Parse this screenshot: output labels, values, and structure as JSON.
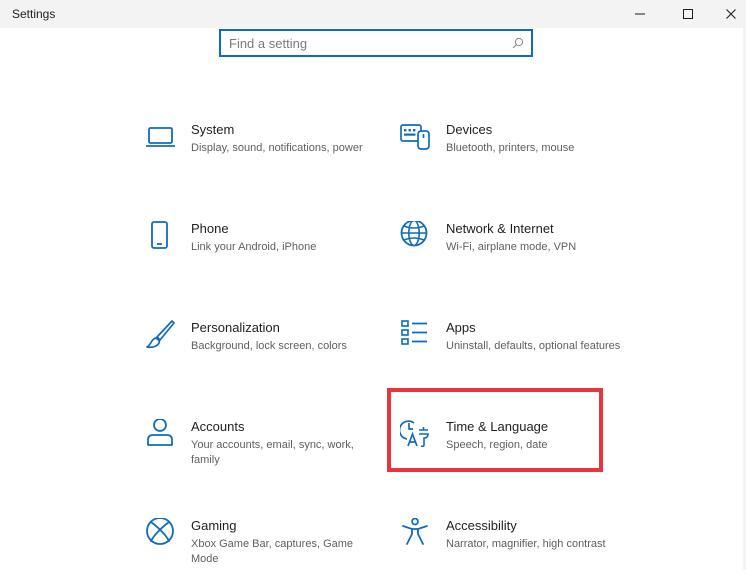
{
  "window": {
    "title": "Settings",
    "minimize_icon": "minimize-icon",
    "maximize_icon": "maximize-icon",
    "close_icon": "close-icon"
  },
  "search": {
    "placeholder": "Find a setting",
    "value": "",
    "icon": "search-icon"
  },
  "tiles": [
    {
      "title": "System",
      "desc": "Display, sound, notifications, power",
      "icon": "laptop-icon"
    },
    {
      "title": "Devices",
      "desc": "Bluetooth, printers, mouse",
      "icon": "devices-icon"
    },
    {
      "title": "Phone",
      "desc": "Link your Android, iPhone",
      "icon": "phone-icon"
    },
    {
      "title": "Network & Internet",
      "desc": "Wi-Fi, airplane mode, VPN",
      "icon": "globe-icon"
    },
    {
      "title": "Personalization",
      "desc": "Background, lock screen, colors",
      "icon": "paintbrush-icon"
    },
    {
      "title": "Apps",
      "desc": "Uninstall, defaults, optional features",
      "icon": "apps-list-icon"
    },
    {
      "title": "Accounts",
      "desc": "Your accounts, email, sync, work, family",
      "icon": "person-icon"
    },
    {
      "title": "Time & Language",
      "desc": "Speech, region, date",
      "icon": "time-language-icon"
    },
    {
      "title": "Gaming",
      "desc": "Xbox Game Bar, captures, Game Mode",
      "icon": "xbox-icon"
    },
    {
      "title": "Accessibility",
      "desc": "Narrator, magnifier, high contrast",
      "icon": "accessibility-icon"
    }
  ],
  "colors": {
    "accent": "#0f6cbd",
    "highlight": "#e8343c"
  }
}
